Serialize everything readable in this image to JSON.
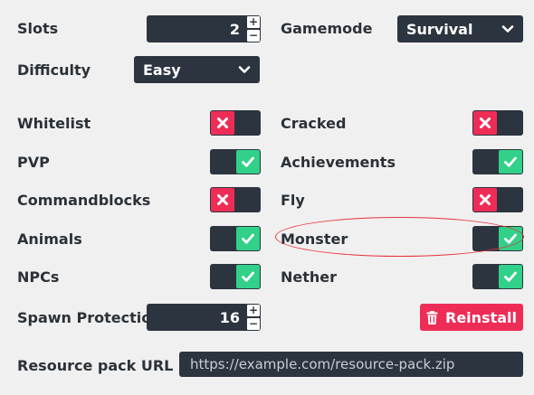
{
  "slots": {
    "label": "Slots",
    "value": "2",
    "plus": "+",
    "minus": "−"
  },
  "gamemode": {
    "label": "Gamemode",
    "value": "Survival"
  },
  "difficulty": {
    "label": "Difficulty",
    "value": "Easy"
  },
  "toggles": {
    "whitelist": {
      "label": "Whitelist",
      "on": false
    },
    "cracked": {
      "label": "Cracked",
      "on": false
    },
    "pvp": {
      "label": "PVP",
      "on": true
    },
    "achievements": {
      "label": "Achievements",
      "on": true
    },
    "commandblocks": {
      "label": "Commandblocks",
      "on": false
    },
    "fly": {
      "label": "Fly",
      "on": false
    },
    "animals": {
      "label": "Animals",
      "on": true
    },
    "monster": {
      "label": "Monster",
      "on": true
    },
    "npcs": {
      "label": "NPCs",
      "on": true
    },
    "nether": {
      "label": "Nether",
      "on": true
    }
  },
  "spawn_protection": {
    "label": "Spawn Protection",
    "value": "16",
    "plus": "+",
    "minus": "−"
  },
  "reinstall": {
    "label": "Reinstall",
    "icon": "trash-icon"
  },
  "resource_pack": {
    "label": "Resource pack URL",
    "value": "https://example.com/resource-pack.zip"
  },
  "colors": {
    "dark": "#2c3440",
    "red": "#ee2d56",
    "green": "#31d189",
    "annotation": "#e8303c"
  }
}
